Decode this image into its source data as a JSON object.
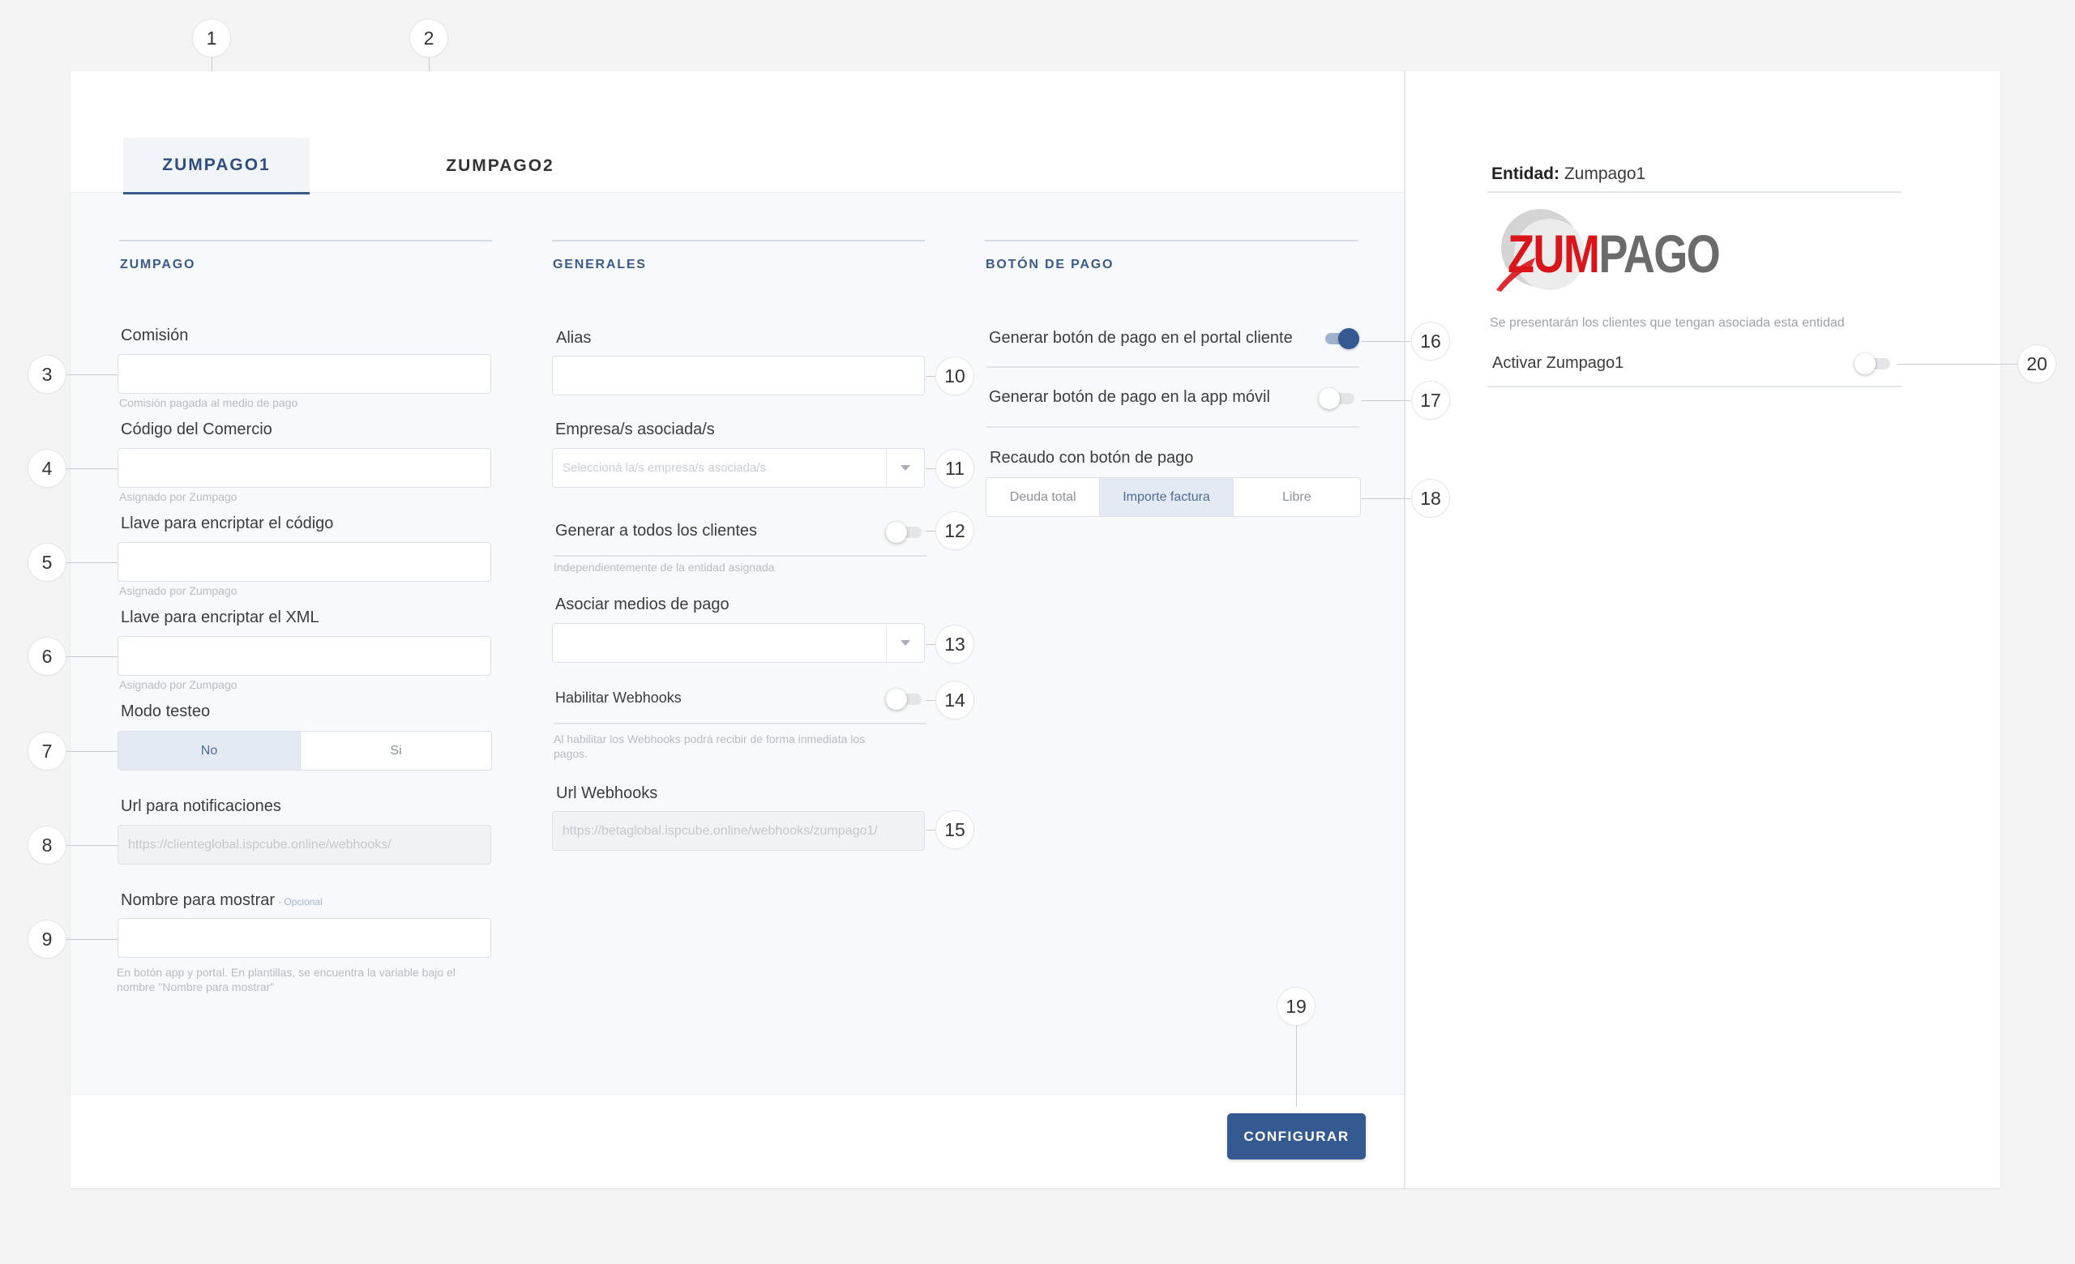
{
  "tabs": [
    {
      "label": "ZUMPAGO1",
      "active": true
    },
    {
      "label": "ZUMPAGO2",
      "active": false
    }
  ],
  "callouts": [
    "1",
    "2",
    "3",
    "4",
    "5",
    "6",
    "7",
    "8",
    "9",
    "10",
    "11",
    "12",
    "13",
    "14",
    "15",
    "16",
    "17",
    "18",
    "19",
    "20"
  ],
  "zumpago": {
    "title": "ZUMPAGO",
    "comision_label": "Comisión",
    "comision_hint": "Comisión pagada al medio de pago",
    "codigo_label": "Código del Comercio",
    "codigo_hint": "Asignado por Zumpago",
    "llave_codigo_label": "Llave para encriptar el código",
    "llave_codigo_hint": "Asignado por Zumpago",
    "llave_xml_label": "Llave para encriptar el XML",
    "llave_xml_hint": "Asignado por Zumpago",
    "modo_label": "Modo testeo",
    "modo_options": [
      "No",
      "Si"
    ],
    "modo_selected": "No",
    "url_label": "Url para notificaciones",
    "url_value": "https://clienteglobal.ispcube.online/webhooks/",
    "nombre_label": "Nombre para mostrar",
    "nombre_optional": "- Opcional",
    "nombre_hint": "En botón app y portal. En plantillas, se encuentra la variable bajo el nombre \"Nombre para mostrar\""
  },
  "generales": {
    "title": "GENERALES",
    "alias_label": "Alias",
    "empresa_label": "Empresa/s asociada/s",
    "empresa_placeholder": "Seleccioná la/s empresa/s asociada/s",
    "generar_label": "Generar a todos los clientes",
    "generar_on": false,
    "generar_hint": "Independientemente de la entidad asignada",
    "medios_label": "Asociar medios de pago",
    "webhooks_label": "Habilitar Webhooks",
    "webhooks_on": false,
    "webhooks_hint": "Al habilitar los Webhooks podrá recibir de forma inmediata los pagos.",
    "url_label": "Url Webhooks",
    "url_value": "https://betaglobal.ispcube.online/webhooks/zumpago1/"
  },
  "boton": {
    "title": "BOTÓN DE PAGO",
    "portal_label": "Generar botón de pago en el portal cliente",
    "portal_on": true,
    "app_label": "Generar botón de pago en la app móvil",
    "app_on": false,
    "recaudo_label": "Recaudo con botón de pago",
    "recaudo_options": [
      "Deuda total",
      "Importe factura",
      "Libre"
    ],
    "recaudo_selected": "Importe factura"
  },
  "footer": {
    "configurar_label": "CONFIGURAR"
  },
  "side": {
    "entidad_label": "Entidad:",
    "entidad_value": "Zumpago1",
    "logo_text_red": "ZUM",
    "logo_text_gray": "PAGO",
    "description": "Se presentarán los clientes que tengan asociada esta entidad",
    "activar_label": "Activar Zumpago1",
    "activar_on": false
  },
  "colors": {
    "accent": "#355a91",
    "logo_red": "#d9151c",
    "logo_gray": "#6b6b6b"
  }
}
